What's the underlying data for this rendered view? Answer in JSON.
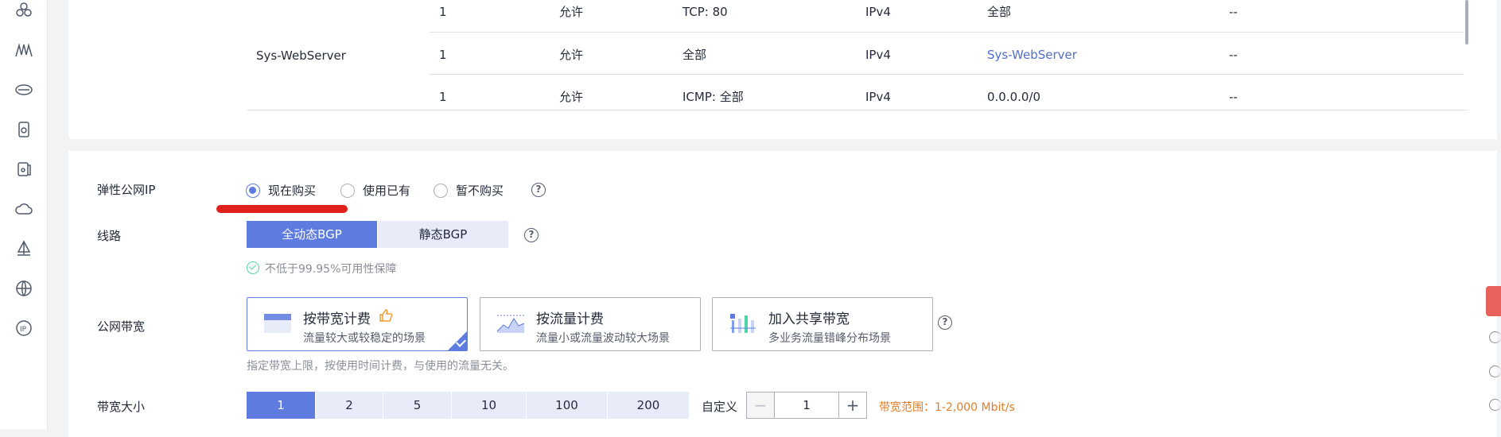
{
  "security_rules": {
    "group_name": "Sys-WebServer",
    "rows": [
      {
        "priority": "1",
        "action": "允许",
        "protocol_port": "TCP: 80",
        "type": "IPv4",
        "source": "全部",
        "description": "--",
        "source_is_link": false
      },
      {
        "priority": "1",
        "action": "允许",
        "protocol_port": "全部",
        "type": "IPv4",
        "source": "Sys-WebServer",
        "description": "--",
        "source_is_link": true
      },
      {
        "priority": "1",
        "action": "允许",
        "protocol_port": "ICMP: 全部",
        "type": "IPv4",
        "source": "0.0.0.0/0",
        "description": "--",
        "source_is_link": false
      }
    ]
  },
  "eip": {
    "label": "弹性公网IP",
    "options": [
      "现在购买",
      "使用已有",
      "暂不购买"
    ],
    "selected": "现在购买"
  },
  "line": {
    "label": "线路",
    "options": [
      "全动态BGP",
      "静态BGP"
    ],
    "selected": "全动态BGP",
    "availability_note": "不低于99.95%可用性保障"
  },
  "bandwidth_billing": {
    "label": "公网带宽",
    "cards": [
      {
        "title": "按带宽计费",
        "subtitle": "流量较大或较稳定的场景",
        "selected": true,
        "recommended": true
      },
      {
        "title": "按流量计费",
        "subtitle": "流量小或流量波动较大场景",
        "selected": false,
        "recommended": false
      },
      {
        "title": "加入共享带宽",
        "subtitle": "多业务流量错峰分布场景",
        "selected": false,
        "recommended": false
      }
    ],
    "description": "指定带宽上限，按使用时间计费，与使用的流量无关。"
  },
  "bandwidth_size": {
    "label": "带宽大小",
    "options": [
      "1",
      "2",
      "5",
      "10",
      "100",
      "200"
    ],
    "selected": "1",
    "custom_label": "自定义",
    "custom_value": "1",
    "range_note": "带宽范围：1-2,000 Mbit/s"
  },
  "colors": {
    "accent": "#5e7ce0",
    "accent_light": "#e8ecf9",
    "warning_text": "#e37d29",
    "success": "#50d4ab",
    "annotation_red": "#e0201c"
  }
}
